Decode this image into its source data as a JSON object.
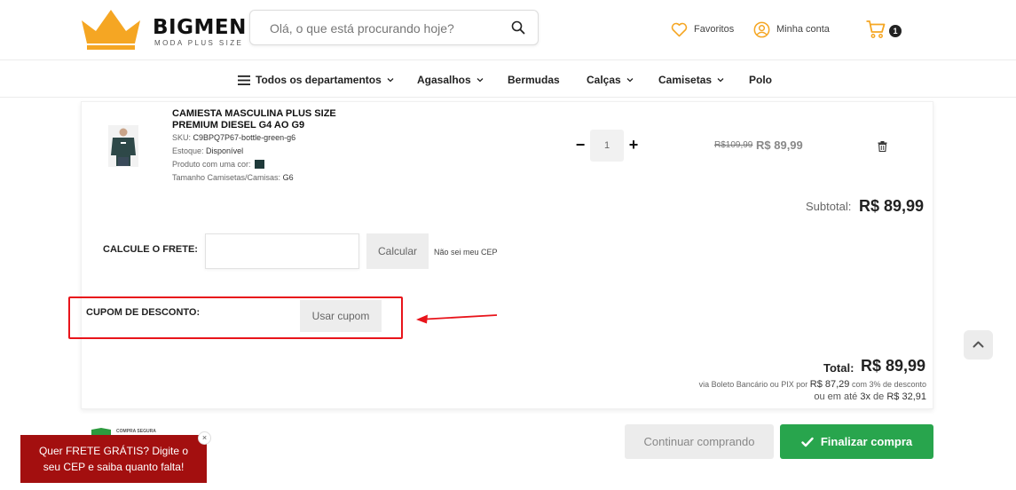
{
  "brand": {
    "name": "BIGMEN",
    "tagline": "MODA PLUS SIZE",
    "accent": "#f5a623"
  },
  "search": {
    "placeholder": "Olá, o que está procurando hoje?"
  },
  "header": {
    "favorites_label": "Favoritos",
    "account_label": "Minha conta",
    "cart_count": "1"
  },
  "nav": {
    "items": [
      {
        "label": "Todos os departamentos",
        "icon": "menu-icon",
        "has_dropdown": true
      },
      {
        "label": "Agasalhos",
        "has_dropdown": true
      },
      {
        "label": "Bermudas",
        "has_dropdown": false
      },
      {
        "label": "Calças",
        "has_dropdown": true
      },
      {
        "label": "Camisetas",
        "has_dropdown": true
      },
      {
        "label": "Polo",
        "has_dropdown": false
      }
    ]
  },
  "cart": {
    "product": {
      "name": "CAMIESTA MASCULINA PLUS SIZE PREMIUM DIESEL G4 ao G9",
      "sku_label": "SKU:",
      "sku": "C9BPQ7P67-bottle-green-g6",
      "stock_label": "Estoque:",
      "stock": "Disponível",
      "color_label": "Produto com uma cor:",
      "color_hex": "#1f3a3a",
      "size_label": "Tamanho Camisetas/Camisas:",
      "size": "G6",
      "quantity": "1",
      "old_price": "R$109,99",
      "price": "R$ 89,99"
    },
    "subtotal_label": "Subtotal:",
    "subtotal_value": "R$ 89,99",
    "shipping": {
      "label": "CALCULE O FRETE:",
      "button_label": "Calcular",
      "cep_link": "Não sei meu CEP"
    },
    "coupon": {
      "label": "CUPOM DE DESCONTO:",
      "button_label": "Usar cupom"
    },
    "total_label": "Total:",
    "total_value": "R$ 89,99",
    "payment": {
      "boleto_prefix": "via Boleto Bancário ou PIX por",
      "boleto_value": "R$ 87,29",
      "boleto_suffix": "com 3% de desconto",
      "installments_prefix": "ou em até",
      "installments_count": "3x",
      "installments_de": "de",
      "installments_value": "R$ 32,91"
    }
  },
  "actions": {
    "continue_label": "Continuar comprando",
    "finalize_label": "Finalizar compra",
    "finalize_color": "#28a54d"
  },
  "seal": {
    "text": "COMPRA SEGURA"
  },
  "promo": {
    "text_line1": "Quer FRETE GRÁTIS? Digite o",
    "text_line2": "seu CEP e saiba quanto falta!",
    "close_glyph": "×",
    "bg_color": "#a30f0f"
  },
  "annotation": {
    "highlight_color": "#e8141b"
  }
}
